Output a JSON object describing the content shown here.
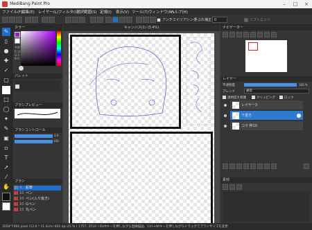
{
  "window": {
    "title": "MediBang Paint Pro"
  },
  "menu": [
    "ファイル(F)",
    "編集(E)",
    "レイヤー(L)",
    "フィルタ(I)",
    "選択範囲(S)",
    "定規(I)",
    "表示(V)",
    "ツール(T)",
    "ウィンドウ(W)",
    "ヘルプ(H)"
  ],
  "toolbar": {
    "antialias_label": "アンチエイリアシング",
    "correction_label": "手ぶれ補正",
    "correction_value": "0",
    "softedge_label": "ソフトエッジ"
  },
  "color_panel": {
    "title": "カラー",
    "hex_text": "#4F1",
    "r": "R:111",
    "g": "G:5",
    "b": "B:0"
  },
  "palette_panel": {
    "title": "パレット"
  },
  "brush_preview": {
    "title": "ブラシプレビュー"
  },
  "brush_control": {
    "title": "ブラシコントロール",
    "size": "3.0",
    "opacity": "100"
  },
  "brush_panel": {
    "title": "ブラシ",
    "items": [
      {
        "size": "3",
        "name": "鉛筆",
        "color": "#6a7fb0"
      },
      {
        "size": "10",
        "name": "ペン",
        "color": "#c04040"
      },
      {
        "size": "10",
        "name": "ペン(入り抜き)",
        "color": "#c04040"
      },
      {
        "size": "10",
        "name": "Gペン",
        "color": "#c04040"
      },
      {
        "size": "15",
        "name": "丸ペン",
        "color": "#c04040"
      }
    ]
  },
  "canvas": {
    "tab_title": "キャンバス(1) (3.4%)"
  },
  "navigator": {
    "title": "ナビゲーター"
  },
  "layers": {
    "title": "レイヤー",
    "opacity_label": "不透明度",
    "opacity_value": "100 %",
    "blend_label": "ブレンド",
    "blend_value": "通常",
    "protect_label": "透明度を保護",
    "clipping_label": "クリッピング",
    "lock_label": "ロック",
    "items": [
      {
        "name": "レイヤー3"
      },
      {
        "name": "下書き"
      },
      {
        "name": "コマ 枠10"
      }
    ]
  },
  "materials": {
    "title": "素材"
  },
  "status": {
    "text": "3028*7460 pixel  (12.6 * 31.6cm)  600 dpi  25 %  ( 1757, 3519 )  Shiftキーを押しながら直線描画、Ctrl+Altキーを押しながらドラッグでブラシサイズを変更"
  }
}
